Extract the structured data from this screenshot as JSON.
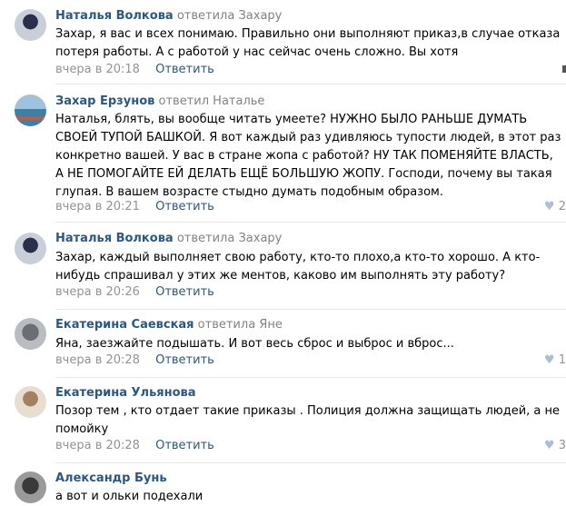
{
  "comments": [
    {
      "author": "Наталья Волкова",
      "verb": "ответила",
      "reply_to": "Захару",
      "text": "Захар, я вас и всех понимаю. Правильно они выполняют приказ,в случае отказа потеря работы. А с работой у нас сейчас очень сложно. Вы хотя",
      "time": "вчера в 20:18",
      "reply_label": "Ответить",
      "likes": ""
    },
    {
      "author": "Захар Ерзунов",
      "verb": "ответил",
      "reply_to": "Наталье",
      "text": "Наталья, блять, вы вообще читать умеете? НУЖНО БЫЛО РАНЬШЕ ДУМАТЬ СВОЕЙ ТУПОЙ БАШКОЙ. Я вот каждый раз удивляюсь тупости людей, в этот раз конкретно вашей. У вас в стране жопа с работой? НУ ТАК ПОМЕНЯЙТЕ ВЛАСТЬ, А НЕ ПОМОГАЙТЕ ЕЙ ДЕЛАТЬ ЕЩЁ БОЛЬШУЮ ЖОПУ. Господи, почему вы такая глупая. В вашем возрасте стыдно думать подобным образом.",
      "time": "вчера в 20:21",
      "reply_label": "Ответить",
      "likes": "2"
    },
    {
      "author": "Наталья Волкова",
      "verb": "ответила",
      "reply_to": "Захару",
      "text": "Захар, каждый выполняет свою работу, кто-то плохо,а кто-то хорошо. А кто-нибудь спрашивал у этих же ментов, каково им выполнять эту работу?",
      "time": "вчера в 20:26",
      "reply_label": "Ответить",
      "likes": ""
    },
    {
      "author": "Екатерина Саевская",
      "verb": "ответила",
      "reply_to": "Яне",
      "text": "Яна, заезжайте подышать. И вот весь сброс и выброс и вброс...",
      "time": "вчера в 20:28",
      "reply_label": "Ответить",
      "likes": "1"
    },
    {
      "author": "Екатерина Ульянова",
      "verb": "",
      "reply_to": "",
      "text": "Позор тем , кто отдает такие приказы . Полиция должна защищать людей, а не помойку",
      "time": "вчера в 20:28",
      "reply_label": "Ответить",
      "likes": "3"
    },
    {
      "author": "Александр Бунь",
      "verb": "",
      "reply_to": "",
      "text": "а вот и ольки подехали",
      "time": "",
      "reply_label": "",
      "likes": ""
    }
  ],
  "colors": {
    "author": "#2a5885",
    "muted": "#939393",
    "heart": "#aebfd1"
  }
}
